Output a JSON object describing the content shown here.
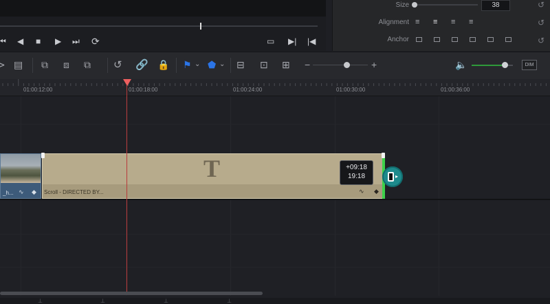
{
  "inspector": {
    "size_label": "Size",
    "size_value": "38",
    "alignment_label": "Alignment",
    "anchor_label": "Anchor"
  },
  "ruler": {
    "timecodes": [
      "01:00:12:00",
      "01:00:18:00",
      "01:00:24:00",
      "01:00:30:00",
      "01:00:36:00"
    ]
  },
  "toolbar": {
    "dim_label": "DIM",
    "zoom_minus": "−",
    "zoom_plus": "+",
    "zoom_level": 0.6,
    "volume_level": 0.82
  },
  "timeline": {
    "video_clip_name": "_h...",
    "title_clip_name": "Scroll - DIRECTED BY...",
    "title_glyph": "T",
    "trim_offset": "+09:18",
    "trim_duration": "19:18"
  },
  "colors": {
    "playhead": "#ee5f5f",
    "title_clip": "#b7ab8c",
    "video_clip": "#3d5b7a",
    "trim_highlight": "#3cd14a",
    "marker_blue": "#2b74e6",
    "volume_green": "#2f9a3a"
  }
}
